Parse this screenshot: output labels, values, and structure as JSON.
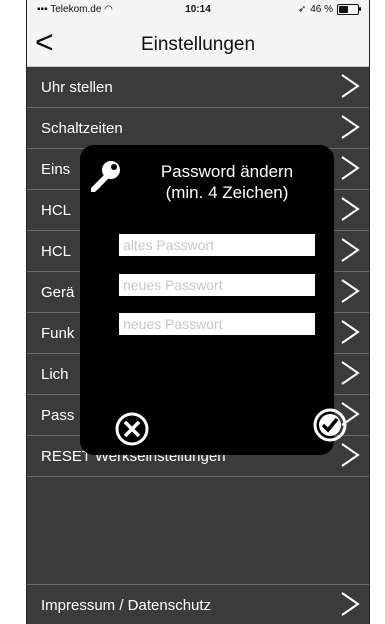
{
  "status": {
    "carrier": "Telekom.de",
    "time": "10:14",
    "battery": "46 %",
    "battery_level": 0.46
  },
  "nav": {
    "back_icon": "chevron-left-icon",
    "title": "Einstellungen"
  },
  "rows": [
    {
      "label": "Uhr stellen"
    },
    {
      "label": "Schaltzeiten"
    },
    {
      "label": "Eins"
    },
    {
      "label": "HCL"
    },
    {
      "label": "HCL"
    },
    {
      "label": "Gerä"
    },
    {
      "label": "Funk"
    },
    {
      "label": "Lich"
    },
    {
      "label": "Pass"
    },
    {
      "label": "RESET Werkseinstellungen"
    }
  ],
  "footer": {
    "label": "Impressum / Datenschutz"
  },
  "dialog": {
    "title_line1": "Password ändern",
    "title_line2": "(min. 4 Zeichen)",
    "old_placeholder": "altes Passwort",
    "new_placeholder": "neues Passwort",
    "confirm_placeholder": "neues Passwort",
    "icon": "key-icon",
    "cancel_icon": "close-circle-icon",
    "confirm_icon": "check-circle-icon"
  },
  "colors": {
    "background": "#3b3b3b",
    "dialog": "#000000",
    "navbar": "#f4f4f4",
    "text": "#ffffff"
  }
}
